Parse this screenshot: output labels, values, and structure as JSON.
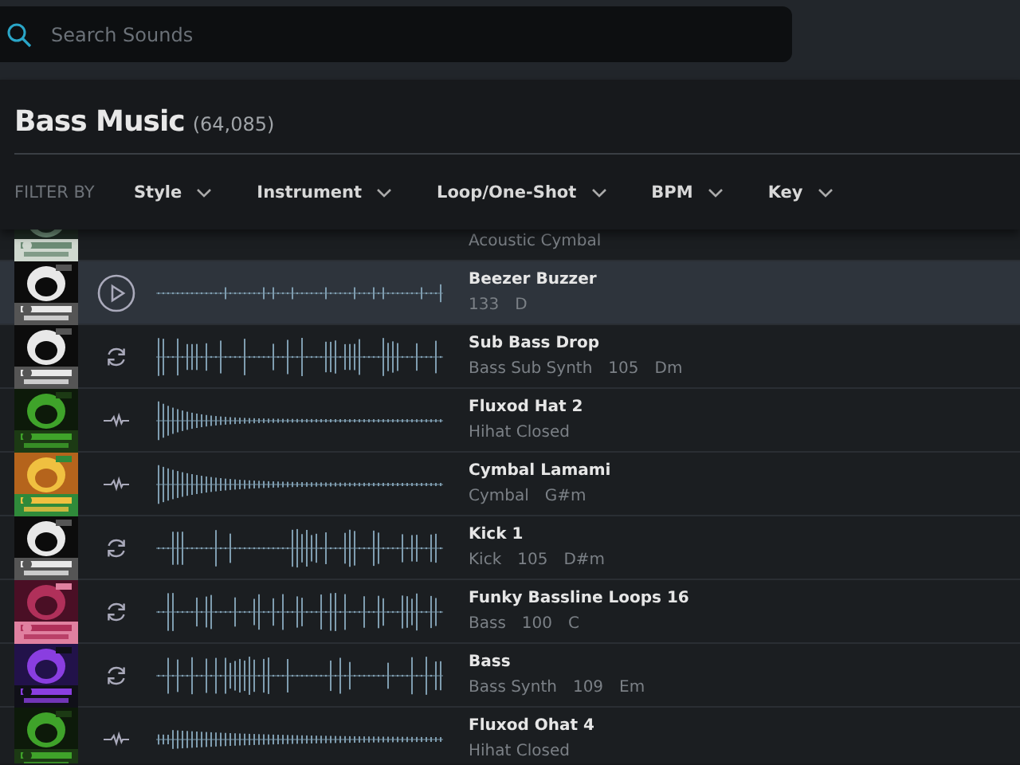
{
  "search": {
    "placeholder": "Search Sounds"
  },
  "heading": {
    "title": "Bass Music",
    "count": "(64,085)"
  },
  "filters": {
    "label": "FILTER BY",
    "items": [
      "Style",
      "Instrument",
      "Loop/One-Shot",
      "BPM",
      "Key"
    ]
  },
  "sounds": [
    {
      "meta": [
        "Acoustic Cymbal"
      ],
      "selected": false
    },
    {
      "kind": "play",
      "title": "Beezer Buzzer",
      "meta": [
        "133",
        "D"
      ],
      "selected": true
    },
    {
      "kind": "loop",
      "title": "Sub Bass Drop",
      "meta": [
        "Bass Sub Synth",
        "105",
        "Dm"
      ],
      "selected": false
    },
    {
      "kind": "oneshot",
      "title": "Fluxod Hat 2",
      "meta": [
        "Hihat Closed"
      ],
      "selected": false
    },
    {
      "kind": "oneshot",
      "title": "Cymbal Lamami",
      "meta": [
        "Cymbal",
        "G#m"
      ],
      "selected": false
    },
    {
      "kind": "loop",
      "title": "Kick 1",
      "meta": [
        "Kick",
        "105",
        "D#m"
      ],
      "selected": false
    },
    {
      "kind": "loop",
      "title": "Funky Bassline Loops 16",
      "meta": [
        "Bass",
        "100",
        "C"
      ],
      "selected": false
    },
    {
      "kind": "loop",
      "title": "Bass",
      "meta": [
        "Bass Synth",
        "109",
        "Em"
      ],
      "selected": false
    },
    {
      "kind": "oneshot",
      "title": "Fluxod Ohat 4",
      "meta": [
        "Hihat Closed"
      ],
      "selected": false
    }
  ]
}
